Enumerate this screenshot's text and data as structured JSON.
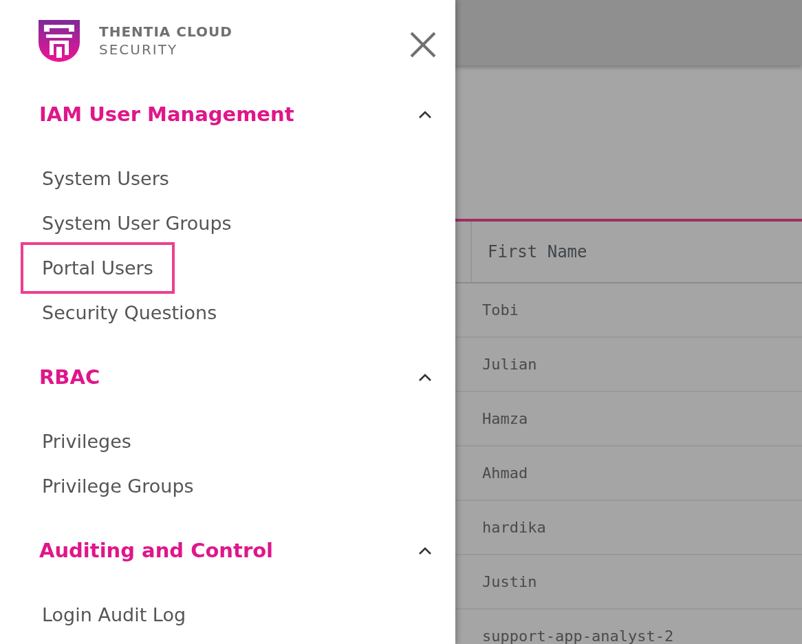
{
  "logo": {
    "line1": "THENTIA CLOUD",
    "line2": "SECURITY"
  },
  "sections": [
    {
      "title": "IAM User Management",
      "expanded": true,
      "items": [
        {
          "label": "System Users",
          "selected": false
        },
        {
          "label": "System User Groups",
          "selected": false
        },
        {
          "label": "Portal Users",
          "selected": true
        },
        {
          "label": "Security Questions",
          "selected": false
        }
      ]
    },
    {
      "title": "RBAC",
      "expanded": true,
      "items": [
        {
          "label": "Privileges",
          "selected": false
        },
        {
          "label": "Privilege Groups",
          "selected": false
        }
      ]
    },
    {
      "title": "Auditing and Control",
      "expanded": true,
      "items": [
        {
          "label": "Login Audit Log",
          "selected": false
        }
      ]
    }
  ],
  "table": {
    "columns": [
      "First Name"
    ],
    "rows": [
      [
        "Tobi"
      ],
      [
        "Julian"
      ],
      [
        "Hamza"
      ],
      [
        "Ahmad"
      ],
      [
        "hardika"
      ],
      [
        "Justin"
      ],
      [
        "support-app-analyst-2"
      ]
    ]
  }
}
